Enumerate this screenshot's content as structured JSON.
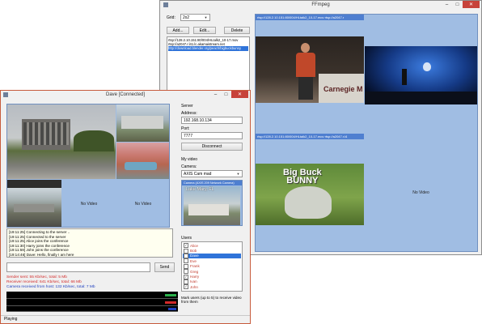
{
  "ffmpeg": {
    "title": "FFmpeg",
    "grid_label": "Grid:",
    "grid_value": "2x2",
    "add_label": "Add...",
    "edit_label": "Edit...",
    "delete_label": "Delete",
    "urls": [
      "rtsp://128.2.10.151:80/004/HLtalk2_10-17.mov",
      "rtsp://a2047.r.l41.lc.akamaistream.net",
      "http://download.blender.org/peach/bigbuckbunny"
    ],
    "selected_url_index": 2,
    "streams": [
      {
        "header": "rtsp://128.2.10.151:80/004/HLtalk2_10-17.mov rtsp://a2047.r",
        "no_video": "",
        "caption": "Carnegie M"
      },
      {
        "header": "",
        "no_video": "",
        "caption": ""
      },
      {
        "header": "rtsp://128.2.10.151:80/004/HLtalk2_10-17.mov rtsp://a2047.r.l4",
        "no_video": "",
        "caption": ""
      },
      {
        "header": "",
        "no_video": "No Video",
        "caption": ""
      }
    ],
    "bunny_title_1": "Big Buck",
    "bunny_title_2": "BUNNY"
  },
  "dave": {
    "title": "Dave [Connected]",
    "cams": [
      {
        "no_video": ""
      },
      {
        "no_video": ""
      },
      {
        "no_video": ""
      },
      {
        "no_video": ""
      },
      {
        "no_video": "No Video"
      },
      {
        "no_video": "No Video"
      }
    ],
    "log": [
      "[19:11:25] Connecting to the server ..",
      "[19:11:25] Connected to the server",
      "[19:11:25] Alice joins the conference",
      "[19:11:30] Harry joins the conference",
      "[19:11:59] John joins the conference",
      "[19:14:46] Dave: Hello, finally I am here"
    ],
    "message_value": "",
    "send_label": "Send",
    "stats": {
      "sender": "Sender sent: 55 Kb/sec, total: 5 Mb",
      "receiver": "Receiver received: 641 Kb/sec, total: 66 Mb",
      "camera": "Camera received from host: 132 Kb/sec, total: 7 Mb"
    },
    "status": "Playing",
    "server_label": "Server",
    "address_label": "Address:",
    "address_value": "192.168.10.134",
    "port_label": "Port:",
    "port_value": "7777",
    "disconnect_label": "Disconnect",
    "myvideo_label": "My video",
    "camera_label": "Camera:",
    "camera_value": "AXIS Cam mad",
    "preview_header": "Camera (AXIS 209 Network Camera)",
    "preview_caption": "Lake Mary, FL",
    "users_label": "Users",
    "users": [
      {
        "name": "Alice",
        "checked": true,
        "selected": false
      },
      {
        "name": "Bob",
        "checked": false,
        "selected": false
      },
      {
        "name": "Dave",
        "checked": false,
        "selected": true
      },
      {
        "name": "Eve",
        "checked": false,
        "selected": false
      },
      {
        "name": "Frank",
        "checked": false,
        "selected": false
      },
      {
        "name": "Greg",
        "checked": false,
        "selected": false
      },
      {
        "name": "Harry",
        "checked": true,
        "selected": false
      },
      {
        "name": "Ivan",
        "checked": false,
        "selected": false
      },
      {
        "name": "John",
        "checked": true,
        "selected": false
      }
    ],
    "hint": "Mark users (up to 5) to receive video from them",
    "colors": {
      "sender": "#d22a2a",
      "receiver": "#d22a2a",
      "camera": "#1f3fbf"
    }
  }
}
